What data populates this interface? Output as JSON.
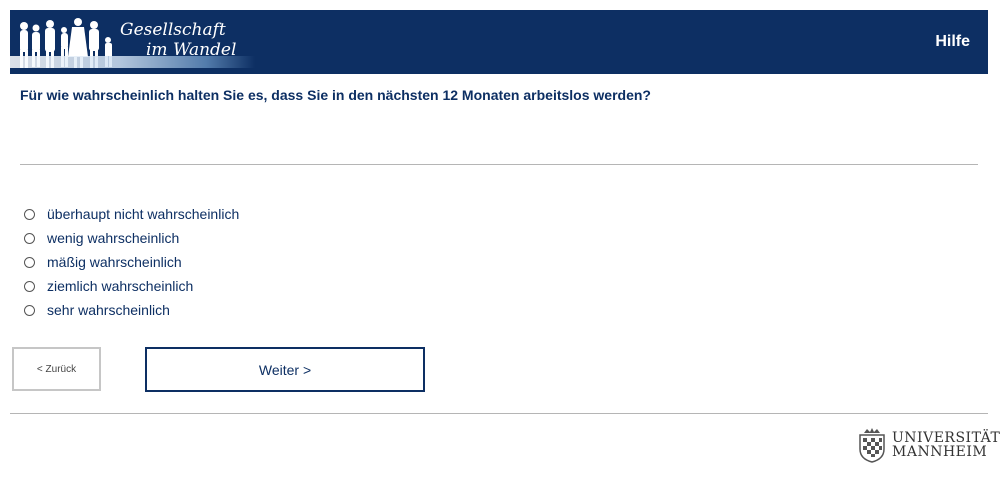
{
  "header": {
    "brand_line1": "Gesellschaft",
    "brand_line2": "im Wandel",
    "help_label": "Hilfe",
    "bg_color": "#0d2f63"
  },
  "question": {
    "text": "Für wie wahrscheinlich halten Sie es, dass Sie in den nächsten 12 Monaten arbeitslos werden?"
  },
  "options": [
    {
      "label": "überhaupt nicht wahrscheinlich",
      "selected": false
    },
    {
      "label": "wenig wahrscheinlich",
      "selected": false
    },
    {
      "label": "mäßig wahrscheinlich",
      "selected": false
    },
    {
      "label": "ziemlich wahrscheinlich",
      "selected": false
    },
    {
      "label": "sehr wahrscheinlich",
      "selected": false
    }
  ],
  "nav": {
    "back_label": "< Zurück",
    "next_label": "Weiter >"
  },
  "footer": {
    "logo_line1": "UNIVERSITÄT",
    "logo_line2": "MANNHEIM"
  }
}
